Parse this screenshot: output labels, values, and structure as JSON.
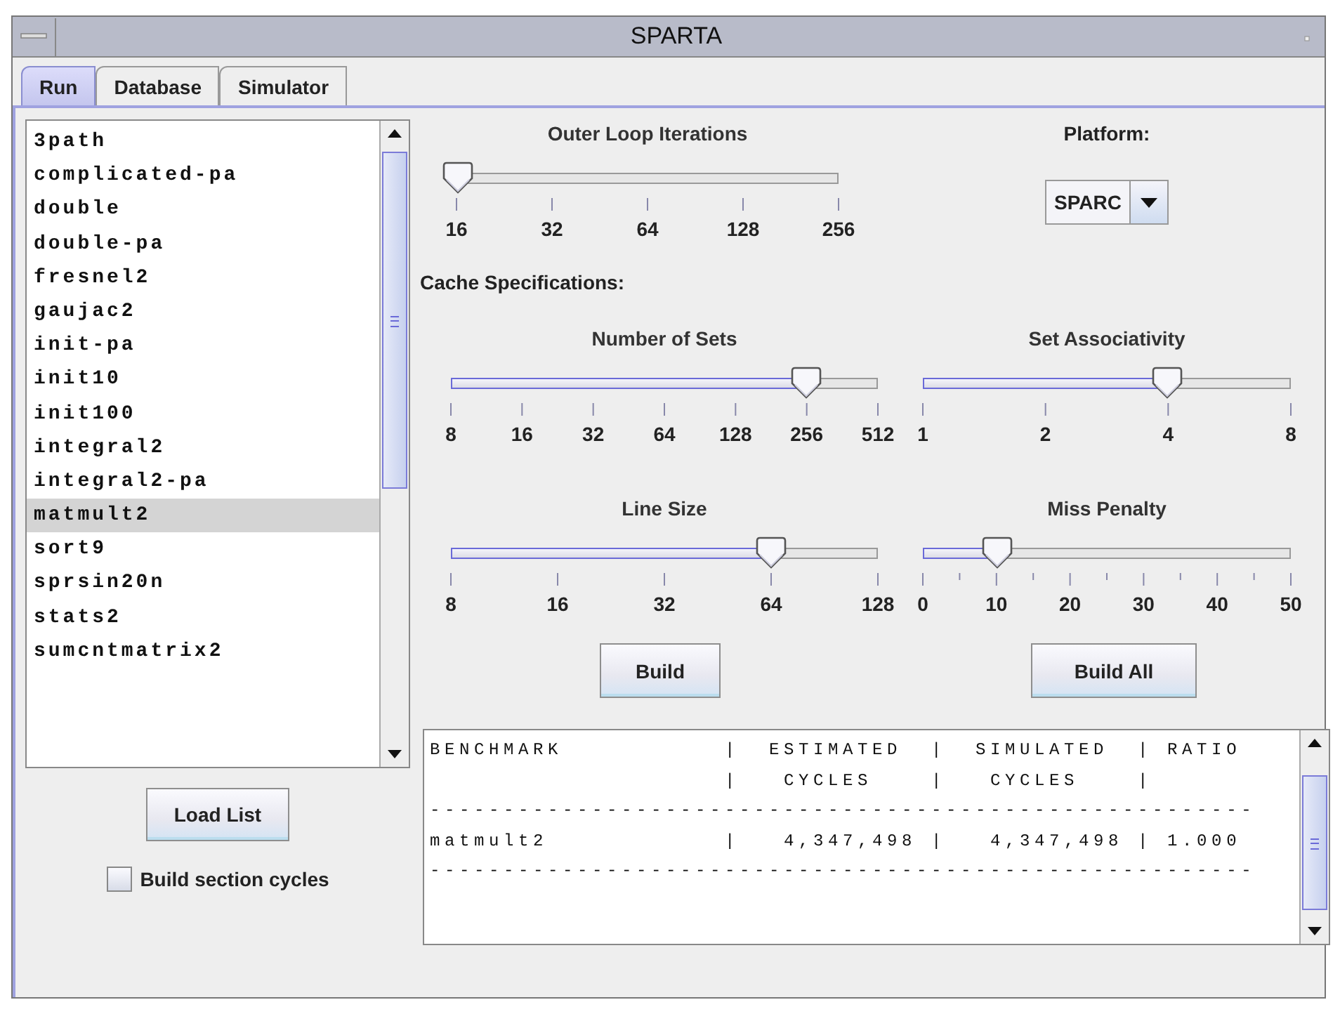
{
  "window": {
    "title": "SPARTA"
  },
  "tabs": [
    {
      "label": "Run",
      "selected": true
    },
    {
      "label": "Database",
      "selected": false
    },
    {
      "label": "Simulator",
      "selected": false
    }
  ],
  "benchmarks": [
    {
      "label": "3path",
      "selected": false
    },
    {
      "label": "complicated-pa",
      "selected": false
    },
    {
      "label": "double",
      "selected": false
    },
    {
      "label": "double-pa",
      "selected": false
    },
    {
      "label": "fresnel2",
      "selected": false
    },
    {
      "label": "gaujac2",
      "selected": false
    },
    {
      "label": "init-pa",
      "selected": false
    },
    {
      "label": "init10",
      "selected": false
    },
    {
      "label": "init100",
      "selected": false
    },
    {
      "label": "integral2",
      "selected": false
    },
    {
      "label": "integral2-pa",
      "selected": false
    },
    {
      "label": "matmult2",
      "selected": true
    },
    {
      "label": "sort9",
      "selected": false
    },
    {
      "label": "sprsin20n",
      "selected": false
    },
    {
      "label": "stats2",
      "selected": false
    },
    {
      "label": "sumcntmatrix2",
      "selected": false
    }
  ],
  "load_button": "Load List",
  "build_section_cycles": {
    "label": "Build section cycles",
    "checked": false
  },
  "outer_loop": {
    "title": "Outer Loop Iterations",
    "level": 0,
    "ticks": [
      "16",
      "32",
      "64",
      "128",
      "256"
    ],
    "minor_ticks": false
  },
  "platform": {
    "label": "Platform:",
    "value": "SPARC"
  },
  "cache_label": "Cache Specifications:",
  "cache_sliders": [
    {
      "title": "Number of Sets",
      "level": 0.833,
      "ticks": [
        "8",
        "16",
        "32",
        "64",
        "128",
        "256",
        "512"
      ],
      "minor_ticks": false
    },
    {
      "title": "Set Associativity",
      "level": 0.667,
      "ticks": [
        "1",
        "2",
        "4",
        "8"
      ],
      "minor_ticks": false
    },
    {
      "title": "Line Size",
      "level": 0.75,
      "ticks": [
        "8",
        "16",
        "32",
        "64",
        "128"
      ],
      "minor_ticks": false
    },
    {
      "title": "Miss Penalty",
      "level": 0.2,
      "ticks": [
        "0",
        "10",
        "20",
        "30",
        "40",
        "50"
      ],
      "minor_ticks": true
    }
  ],
  "build_buttons": [
    "Build",
    "Build All"
  ],
  "results": {
    "lines": [
      "BENCHMARK           |  ESTIMATED  |  SIMULATED  | RATIO",
      "                    |   CYCLES    |   CYCLES    |",
      "--------------------------------------------------------",
      "matmult2            |   4,347,498 |   4,347,498 | 1.000",
      "--------------------------------------------------------"
    ]
  }
}
